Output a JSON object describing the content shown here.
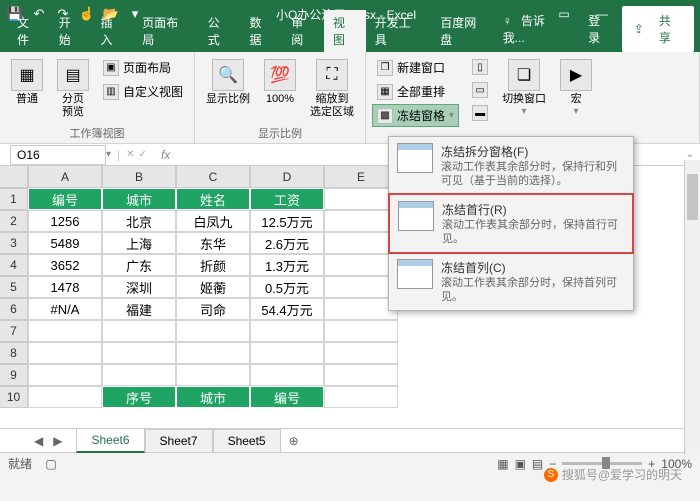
{
  "title": "小Q办公演示2.xlsx - Excel",
  "qat": [
    "save",
    "undo",
    "redo",
    "touch",
    "open",
    "more"
  ],
  "tabs": [
    "文件",
    "开始",
    "插入",
    "页面布局",
    "公式",
    "数据",
    "审阅",
    "视图",
    "开发工具",
    "百度网盘"
  ],
  "tellme": "告诉我...",
  "login": "登录",
  "share": "共享",
  "ribbon": {
    "g1": {
      "label": "工作簿视图",
      "b1": "普通",
      "b2": "分页\n预览",
      "s1": "页面布局",
      "s2": "自定义视图"
    },
    "g2": {
      "label": "显示比例",
      "b1": "显示比例",
      "b2": "100%",
      "b3": "缩放到\n选定区域"
    },
    "g3": {
      "s1": "新建窗口",
      "s2": "全部重排",
      "s3": "冻结窗格",
      "b1": "切换窗口",
      "b2": "宏"
    }
  },
  "namebox": "O16",
  "fx": "fx",
  "cols": [
    "A",
    "B",
    "C",
    "D",
    "E"
  ],
  "rows": [
    "1",
    "2",
    "3",
    "4",
    "5",
    "6",
    "7",
    "8",
    "9",
    "10"
  ],
  "table": {
    "header": [
      "编号",
      "城市",
      "姓名",
      "工资"
    ],
    "rows": [
      [
        "1256",
        "北京",
        "白凤九",
        "12.5万元"
      ],
      [
        "5489",
        "上海",
        "东华",
        "2.6万元"
      ],
      [
        "3652",
        "广东",
        "折颜",
        "1.3万元"
      ],
      [
        "1478",
        "深圳",
        "姬蘅",
        "0.5万元"
      ],
      [
        "#N/A",
        "福建",
        "司命",
        "54.4万元"
      ]
    ],
    "footer": [
      "序号",
      "城市",
      "编号"
    ]
  },
  "sheets": [
    "Sheet6",
    "Sheet7",
    "Sheet5"
  ],
  "dropdown": [
    {
      "t": "冻结拆分窗格(F)",
      "d": "滚动工作表其余部分时，保持行和列可见（基于当前的选择）。"
    },
    {
      "t": "冻结首行(R)",
      "d": "滚动工作表其余部分时，保持首行可见。"
    },
    {
      "t": "冻结首列(C)",
      "d": "滚动工作表其余部分时，保持首列可见。"
    }
  ],
  "status": {
    "ready": "就绪",
    "rec": "",
    "zoom": "100%"
  },
  "watermark": "搜狐号@爱学习的明天"
}
